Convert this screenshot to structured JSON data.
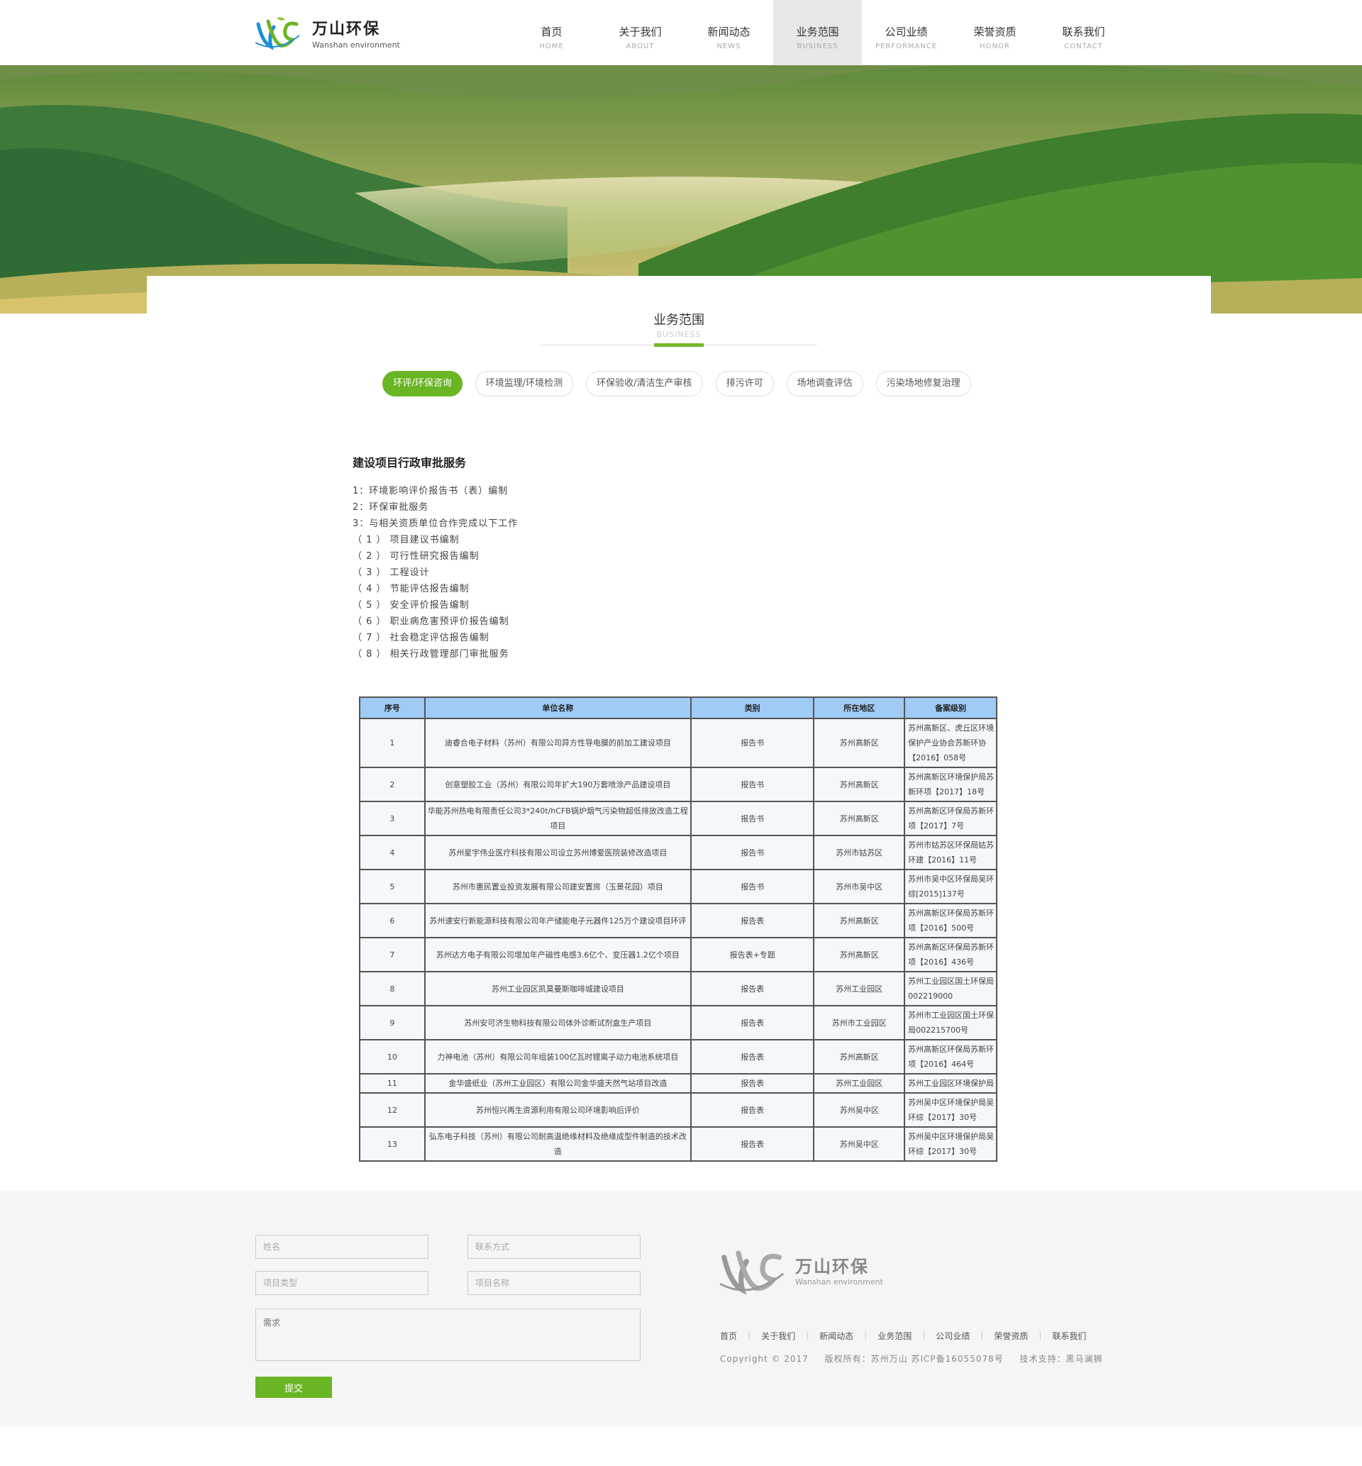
{
  "header": {
    "logo_cn": "万山环保",
    "logo_en": "Wanshan environment",
    "nav": [
      {
        "cn": "首页",
        "en": "HOME"
      },
      {
        "cn": "关于我们",
        "en": "ABOUT"
      },
      {
        "cn": "新闻动态",
        "en": "NEWS"
      },
      {
        "cn": "业务范围",
        "en": "BUSINESS"
      },
      {
        "cn": "公司业绩",
        "en": "PERFORMANCE"
      },
      {
        "cn": "荣誉资质",
        "en": "HONOR"
      },
      {
        "cn": "联系我们",
        "en": "CONTACT"
      }
    ],
    "active_nav": "业务范围"
  },
  "section": {
    "title_cn": "业务范围",
    "title_en": "BUSINESS"
  },
  "tabs": [
    "环评/环保咨询",
    "环境监理/环境检测",
    "环保验收/清洁生产审核",
    "排污许可",
    "场地调查评估",
    "污染场地修复治理"
  ],
  "active_tab": "环评/环保咨询",
  "service": {
    "heading": "建设项目行政审批服务",
    "items": [
      "1：环境影响评价报告书（表）编制",
      "2：环保审批服务",
      "3：与相关资质单位合作完成以下工作",
      "（ 1 ） 项目建议书编制",
      "（ 2 ） 可行性研究报告编制",
      "（ 3 ） 工程设计",
      "（ 4 ） 节能评估报告编制",
      "（ 5 ） 安全评价报告编制",
      "（ 6 ） 职业病危害预评价报告编制",
      "（ 7 ） 社会稳定评估报告编制",
      "（ 8 ） 相关行政管理部门审批服务"
    ]
  },
  "table": {
    "headers": [
      "序号",
      "单位名称",
      "类别",
      "所在地区",
      "备案级别"
    ],
    "rows": [
      [
        "1",
        "迪睿合电子材料（苏州）有限公司异方性导电膜的前加工建设项目",
        "报告书",
        "苏州高新区",
        "苏州高新区、虎丘区环境保护产业协会苏新环协【2016】058号"
      ],
      [
        "2",
        "创意塑胶工业（苏州）有限公司年扩大190万套喷涂产品建设项目",
        "报告书",
        "苏州高新区",
        "苏州高新区环境保护局苏新环项【2017】18号"
      ],
      [
        "3",
        "华能苏州热电有限责任公司3*240t/hCFB锅炉烟气污染物超低排放改造工程项目",
        "报告书",
        "苏州高新区",
        "苏州高新区环保局苏新环项【2017】7号"
      ],
      [
        "4",
        "苏州星宇伟业医疗科技有限公司设立苏州博爱医院装修改造项目",
        "报告书",
        "苏州市姑苏区",
        "苏州市姑苏区环保局姑苏环建【2016】11号"
      ],
      [
        "5",
        "苏州市惠民置业投资发展有限公司建安置房（玉景花园）项目",
        "报告书",
        "苏州市吴中区",
        "苏州市吴中区环保局吴环综[2015]137号"
      ],
      [
        "6",
        "苏州速安行新能源科技有限公司年产储能电子元器件125万个建设项目环评",
        "报告表",
        "苏州高新区",
        "苏州高新区环保局苏新环项【2016】500号"
      ],
      [
        "7",
        "苏州达方电子有限公司增加年产磁性电感3.6亿个、变压器1.2亿个项目",
        "报告表+专题",
        "苏州高新区",
        "苏州高新区环保局苏新环项【2016】436号"
      ],
      [
        "8",
        "苏州工业园区凯莫曼斯咖啡城建设项目",
        "报告表",
        "苏州工业园区",
        "苏州工业园区国土环保局002219000"
      ],
      [
        "9",
        "苏州安可济生物科技有限公司体外诊断试剂盒生产项目",
        "报告表",
        "苏州市工业园区",
        "苏州市工业园区国土环保局002215700号"
      ],
      [
        "10",
        "力神电池（苏州）有限公司年组装100亿瓦时锂离子动力电池系统项目",
        "报告表",
        "苏州高新区",
        "苏州高新区环保局苏新环项【2016】464号"
      ],
      [
        "11",
        "金华盛纸业（苏州工业园区）有限公司金华盛天然气站项目改造",
        "报告表",
        "苏州工业园区",
        "苏州工业园区环境保护局"
      ],
      [
        "12",
        "苏州恒兴再生资源利用有限公司环境影响后评价",
        "报告表",
        "苏州吴中区",
        "苏州吴中区环境保护局吴环综【2017】30号"
      ],
      [
        "13",
        "弘东电子科技（苏州）有限公司耐高温绝缘材料及绝缘成型件制造的技术改造",
        "报告表",
        "苏州吴中区",
        "苏州吴中区环境保护局吴环综【2017】30号"
      ]
    ]
  },
  "footer": {
    "form": {
      "name_placeholder": "姓名",
      "contact_placeholder": "联系方式",
      "type_placeholder": "项目类型",
      "project_placeholder": "项目名称",
      "need_placeholder": "需求",
      "submit_label": "提交"
    },
    "logo_cn": "万山环保",
    "logo_en": "Wanshan environment",
    "nav": [
      "首页",
      "关于我们",
      "新闻动态",
      "业务范围",
      "公司业绩",
      "荣誉资质",
      "联系我们"
    ],
    "copyright": "Copyright © 2017",
    "rights": "版权所有：苏州万山 苏ICP备16055078号",
    "support": "技术支持：黑马澜狮"
  },
  "colors": {
    "accent": "#6ab523",
    "table_header": "#9fcbf5",
    "footer_bg": "#f5f5f5"
  }
}
